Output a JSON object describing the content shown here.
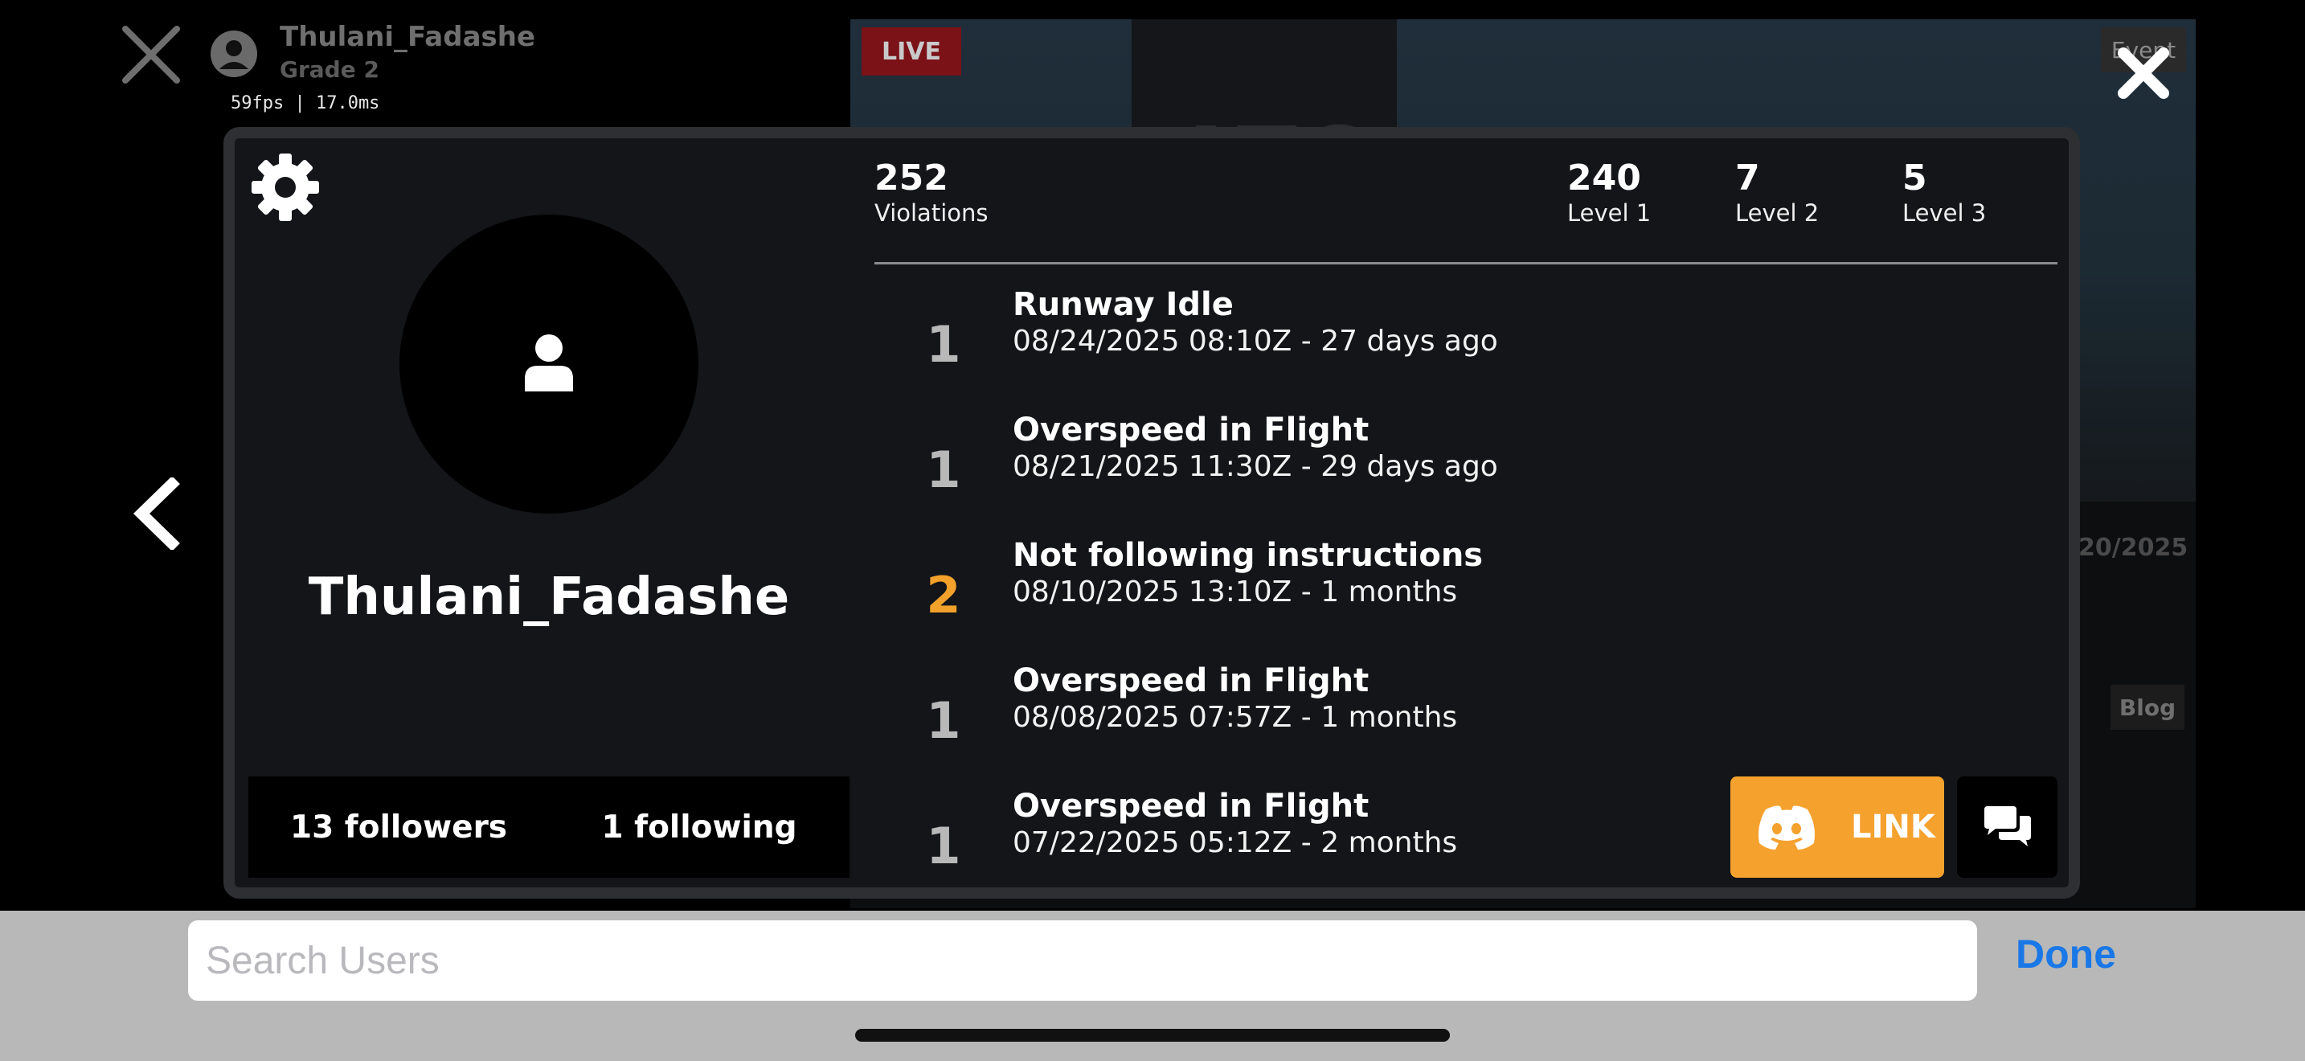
{
  "background": {
    "username": "Thulani_Fadashe",
    "grade": "Grade 2",
    "fps_readout": "59fps | 17.0ms",
    "live_badge": "LIVE",
    "event_badge": "Event",
    "blog_badge": "Blog",
    "date_fragment": "20/2025"
  },
  "profile": {
    "name": "Thulani_Fadashe",
    "followers": "13 followers",
    "following": "1 following"
  },
  "stats": {
    "violations": {
      "value": "252",
      "label": "Violations"
    },
    "level1": {
      "value": "240",
      "label": "Level 1"
    },
    "level2": {
      "value": "7",
      "label": "Level 2"
    },
    "level3": {
      "value": "5",
      "label": "Level 3"
    }
  },
  "violations": [
    {
      "level": "1",
      "title": "Runway Idle",
      "time": "08/24/2025 08:10Z - 27 days ago"
    },
    {
      "level": "1",
      "title": "Overspeed in Flight",
      "time": "08/21/2025 11:30Z - 29 days ago"
    },
    {
      "level": "2",
      "title": "Not following instructions",
      "time": "08/10/2025 13:10Z - 1 months"
    },
    {
      "level": "1",
      "title": "Overspeed in Flight",
      "time": "08/08/2025 07:57Z - 1 months"
    },
    {
      "level": "1",
      "title": "Overspeed in Flight",
      "time": "07/22/2025 05:12Z - 2 months"
    }
  ],
  "actions": {
    "discord_link_label": "LINK"
  },
  "search": {
    "placeholder": "Search Users",
    "value": "",
    "done_label": "Done"
  },
  "colors": {
    "accent_orange": "#f5a12e",
    "level2_color": "#f2a12b",
    "done_blue": "#1a78e6"
  },
  "icons": [
    "close-icon",
    "back-chevron-icon",
    "gear-icon",
    "user-icon",
    "discord-icon",
    "chat-bubbles-icon"
  ]
}
